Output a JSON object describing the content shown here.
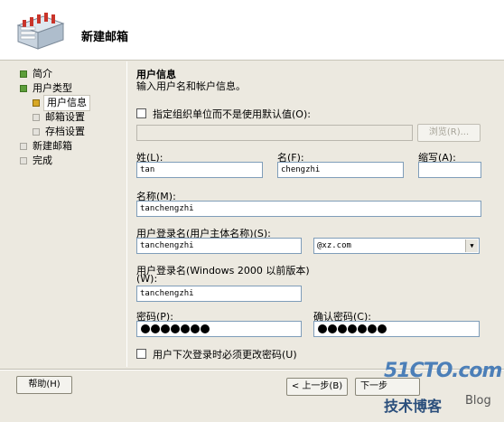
{
  "wizard": {
    "title": "新建邮箱"
  },
  "nav": {
    "items": [
      {
        "label": "简介",
        "state": "done"
      },
      {
        "label": "用户类型",
        "state": "done"
      },
      {
        "label": "用户信息",
        "state": "current"
      },
      {
        "label": "邮箱设置",
        "state": "pending"
      },
      {
        "label": "存档设置",
        "state": "pending"
      },
      {
        "label": "新建邮箱",
        "state": "pending"
      },
      {
        "label": "完成",
        "state": "pending"
      }
    ]
  },
  "section": {
    "title": "用户信息",
    "description": "输入用户名和帐户信息。"
  },
  "form": {
    "ou_checkbox_label": "指定组织单位而不是使用默认值(O):",
    "ou_path": "",
    "browse_label": "浏览(R)...",
    "last_name_label": "姓(L):",
    "last_name": "tan",
    "first_name_label": "名(F):",
    "first_name": "chengzhi",
    "initials_label": "缩写(A):",
    "initials": "",
    "name_label": "名称(M):",
    "name": "tanchengzhi",
    "upn_label": "用户登录名(用户主体名称)(S):",
    "upn": "tanchengzhi",
    "domain": "@xz.com",
    "pre2000_label": "用户登录名(Windows 2000 以前版本)",
    "pre2000_label2": "(W):",
    "pre2000": "tanchengzhi",
    "password_label": "密码(P):",
    "confirm_label": "确认密码(C):",
    "password_mask_length": 7,
    "change_pw_label": "用户下次登录时必须更改密码(U)"
  },
  "footer": {
    "help": "帮助(H)",
    "back": "< 上一步(B)",
    "next": "下一步"
  },
  "watermark": {
    "brand": "51CTO.com",
    "blog_cn": "技术博客",
    "blog": "Blog"
  }
}
